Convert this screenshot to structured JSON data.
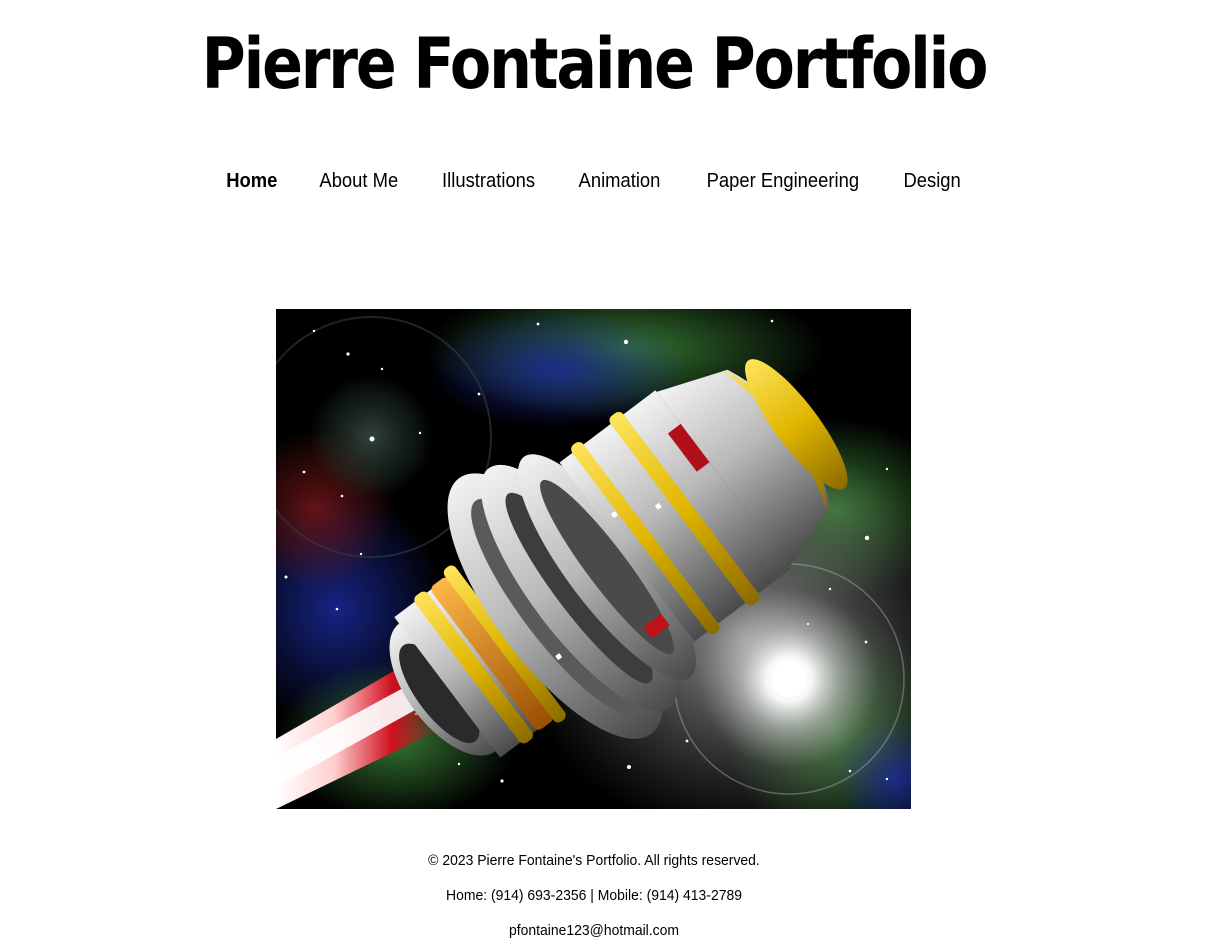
{
  "header": {
    "title": "Pierre Fontaine Portfolio"
  },
  "nav": {
    "items": [
      {
        "label": "Home",
        "active": true
      },
      {
        "label": "About Me",
        "active": false
      },
      {
        "label": "Illustrations",
        "active": false
      },
      {
        "label": "Animation",
        "active": false
      },
      {
        "label": "Paper Engineering",
        "active": false
      },
      {
        "label": "Design",
        "active": false
      }
    ]
  },
  "hero": {
    "image_subject": "spaceship-illustration"
  },
  "footer": {
    "copyright": "© 2023 Pierre Fontaine's Portfolio. All rights reserved.",
    "phones": "Home: (914) 693-2356 | Mobile: (914) 413-2789",
    "email": "pfontaine123@hotmail.com"
  },
  "colors": {
    "text": "#000000",
    "background": "#ffffff",
    "ship_gold": "#e0b600",
    "ship_red": "#c0101a"
  }
}
